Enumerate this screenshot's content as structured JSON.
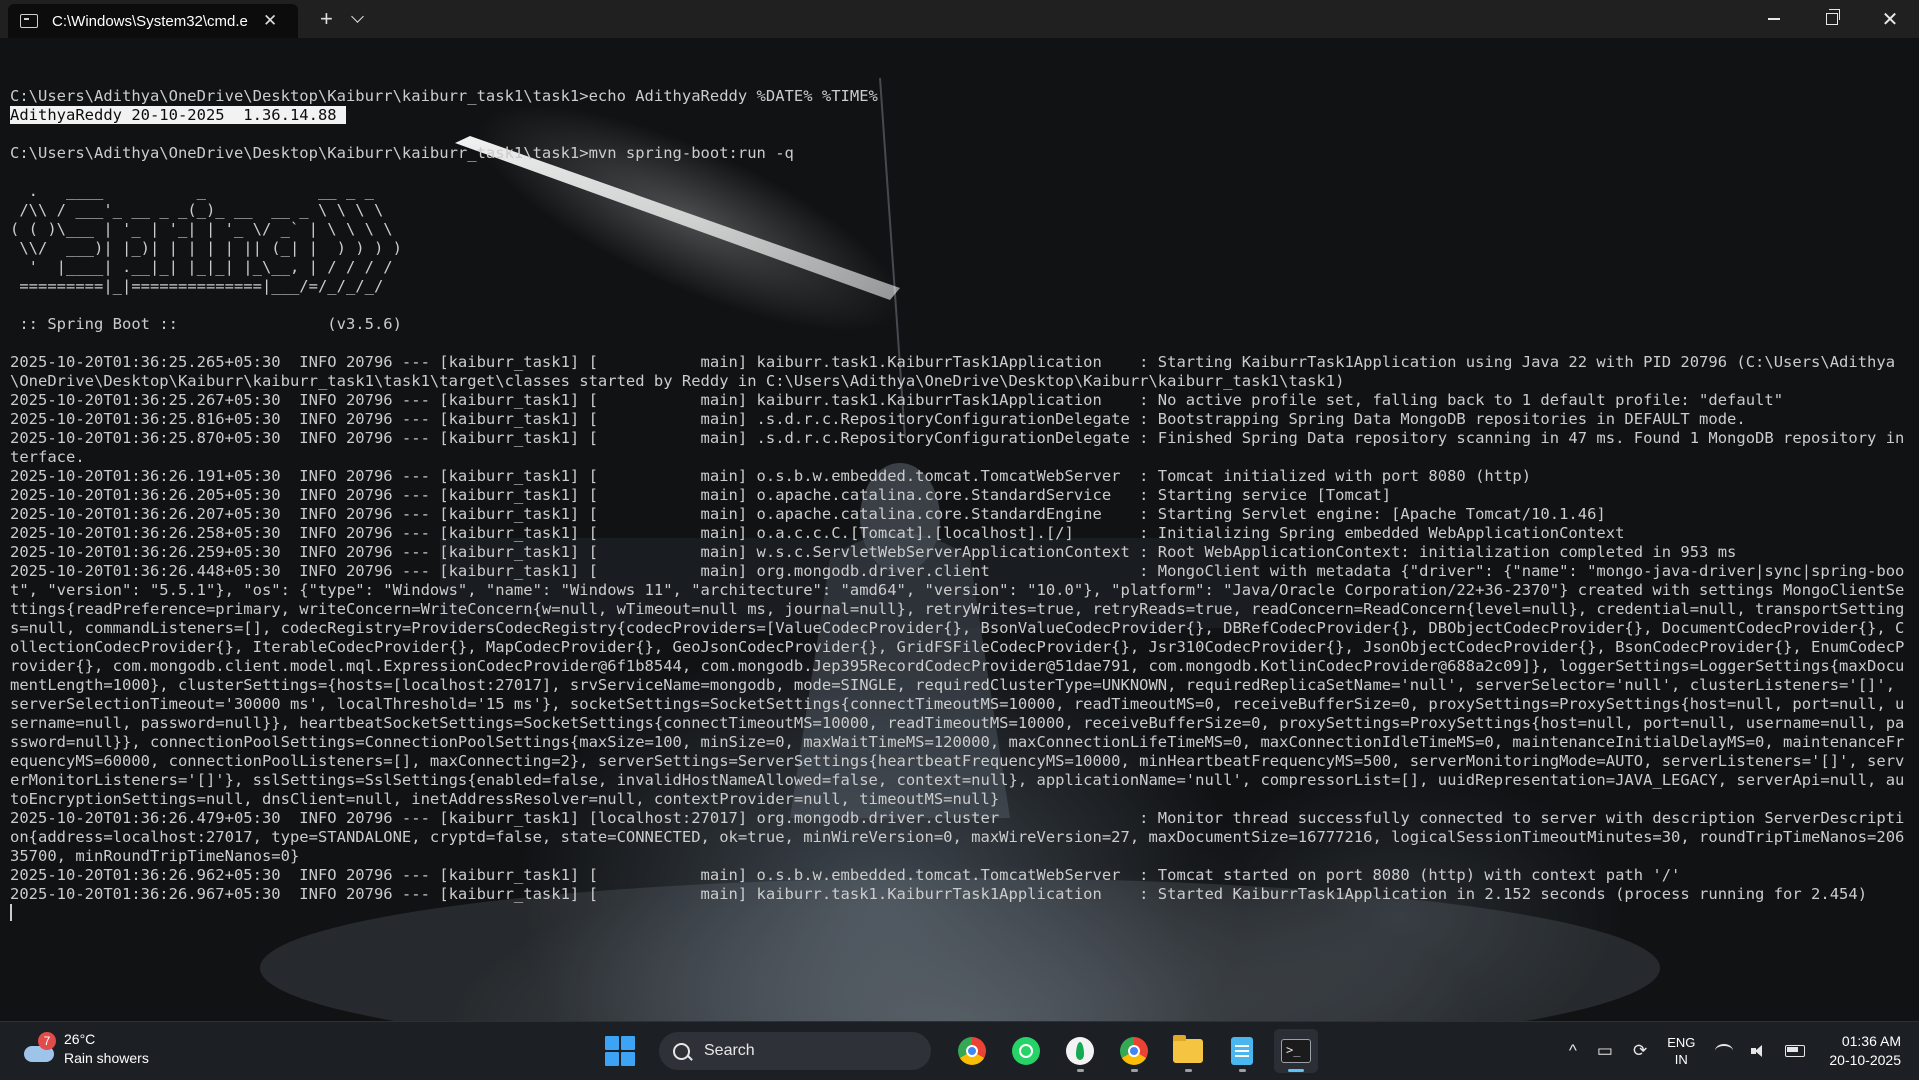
{
  "window": {
    "tab_title": "C:\\Windows\\System32\\cmd.e",
    "tab_close": "✕",
    "new_tab": "+",
    "minimize_label": "Minimize",
    "maximize_label": "Restore",
    "close_label": "✕"
  },
  "terminal": {
    "lines": [
      "",
      "C:\\Users\\Adithya\\OneDrive\\Desktop\\Kaiburr\\kaiburr_task1\\task1>echo AdithyaReddy %DATE% %TIME%",
      "AdithyaReddy 20-10-2025  1.36.14.88 ",
      "",
      "C:\\Users\\Adithya\\OneDrive\\Desktop\\Kaiburr\\kaiburr_task1\\task1>mvn spring-boot:run -q",
      "",
      "  .   ____          _            __ _ _",
      " /\\\\ / ___'_ __ _ _(_)_ __  __ _ \\ \\ \\ \\",
      "( ( )\\___ | '_ | '_| | '_ \\/ _` | \\ \\ \\ \\",
      " \\\\/  ___)| |_)| | | | | || (_| |  ) ) ) )",
      "  '  |____| .__|_| |_|_| |_\\__, | / / / /",
      " =========|_|==============|___/=/_/_/_/",
      "",
      " :: Spring Boot ::                (v3.5.6)",
      "",
      "2025-10-20T01:36:25.265+05:30  INFO 20796 --- [kaiburr_task1] [           main] kaiburr.task1.KaiburrTask1Application    : Starting KaiburrTask1Application using Java 22 with PID 20796 (C:\\Users\\Adithya\\OneDrive\\Desktop\\Kaiburr\\kaiburr_task1\\task1\\target\\classes started by Reddy in C:\\Users\\Adithya\\OneDrive\\Desktop\\Kaiburr\\kaiburr_task1\\task1)",
      "2025-10-20T01:36:25.267+05:30  INFO 20796 --- [kaiburr_task1] [           main] kaiburr.task1.KaiburrTask1Application    : No active profile set, falling back to 1 default profile: \"default\"",
      "2025-10-20T01:36:25.816+05:30  INFO 20796 --- [kaiburr_task1] [           main] .s.d.r.c.RepositoryConfigurationDelegate : Bootstrapping Spring Data MongoDB repositories in DEFAULT mode.",
      "2025-10-20T01:36:25.870+05:30  INFO 20796 --- [kaiburr_task1] [           main] .s.d.r.c.RepositoryConfigurationDelegate : Finished Spring Data repository scanning in 47 ms. Found 1 MongoDB repository interface.",
      "2025-10-20T01:36:26.191+05:30  INFO 20796 --- [kaiburr_task1] [           main] o.s.b.w.embedded.tomcat.TomcatWebServer  : Tomcat initialized with port 8080 (http)",
      "2025-10-20T01:36:26.205+05:30  INFO 20796 --- [kaiburr_task1] [           main] o.apache.catalina.core.StandardService   : Starting service [Tomcat]",
      "2025-10-20T01:36:26.207+05:30  INFO 20796 --- [kaiburr_task1] [           main] o.apache.catalina.core.StandardEngine    : Starting Servlet engine: [Apache Tomcat/10.1.46]",
      "2025-10-20T01:36:26.258+05:30  INFO 20796 --- [kaiburr_task1] [           main] o.a.c.c.C.[Tomcat].[localhost].[/]       : Initializing Spring embedded WebApplicationContext",
      "2025-10-20T01:36:26.259+05:30  INFO 20796 --- [kaiburr_task1] [           main] w.s.c.ServletWebServerApplicationContext : Root WebApplicationContext: initialization completed in 953 ms",
      "2025-10-20T01:36:26.448+05:30  INFO 20796 --- [kaiburr_task1] [           main] org.mongodb.driver.client                : MongoClient with metadata {\"driver\": {\"name\": \"mongo-java-driver|sync|spring-boot\", \"version\": \"5.5.1\"}, \"os\": {\"type\": \"Windows\", \"name\": \"Windows 11\", \"architecture\": \"amd64\", \"version\": \"10.0\"}, \"platform\": \"Java/Oracle Corporation/22+36-2370\"} created with settings MongoClientSettings{readPreference=primary, writeConcern=WriteConcern{w=null, wTimeout=null ms, journal=null}, retryWrites=true, retryReads=true, readConcern=ReadConcern{level=null}, credential=null, transportSettings=null, commandListeners=[], codecRegistry=ProvidersCodecRegistry{codecProviders=[ValueCodecProvider{}, BsonValueCodecProvider{}, DBRefCodecProvider{}, DBObjectCodecProvider{}, DocumentCodecProvider{}, CollectionCodecProvider{}, IterableCodecProvider{}, MapCodecProvider{}, GeoJsonCodecProvider{}, GridFSFileCodecProvider{}, Jsr310CodecProvider{}, JsonObjectCodecProvider{}, BsonCodecProvider{}, EnumCodecProvider{}, com.mongodb.client.model.mql.ExpressionCodecProvider@6f1b8544, com.mongodb.Jep395RecordCodecProvider@51dae791, com.mongodb.KotlinCodecProvider@688a2c09]}, loggerSettings=LoggerSettings{maxDocumentLength=1000}, clusterSettings={hosts=[localhost:27017], srvServiceName=mongodb, mode=SINGLE, requiredClusterType=UNKNOWN, requiredReplicaSetName='null', serverSelector='null', clusterListeners='[]', serverSelectionTimeout='30000 ms', localThreshold='15 ms'}, socketSettings=SocketSettings{connectTimeoutMS=10000, readTimeoutMS=0, receiveBufferSize=0, proxySettings=ProxySettings{host=null, port=null, username=null, password=null}}, heartbeatSocketSettings=SocketSettings{connectTimeoutMS=10000, readTimeoutMS=10000, receiveBufferSize=0, proxySettings=ProxySettings{host=null, port=null, username=null, password=null}}, connectionPoolSettings=ConnectionPoolSettings{maxSize=100, minSize=0, maxWaitTimeMS=120000, maxConnectionLifeTimeMS=0, maxConnectionIdleTimeMS=0, maintenanceInitialDelayMS=0, maintenanceFrequencyMS=60000, connectionPoolListeners=[], maxConnecting=2}, serverSettings=ServerSettings{heartbeatFrequencyMS=10000, minHeartbeatFrequencyMS=500, serverMonitoringMode=AUTO, serverListeners='[]', serverMonitorListeners='[]'}, sslSettings=SslSettings{enabled=false, invalidHostNameAllowed=false, context=null}, applicationName='null', compressorList=[], uuidRepresentation=JAVA_LEGACY, serverApi=null, autoEncryptionSettings=null, dnsClient=null, inetAddressResolver=null, contextProvider=null, timeoutMS=null}",
      "2025-10-20T01:36:26.479+05:30  INFO 20796 --- [kaiburr_task1] [localhost:27017] org.mongodb.driver.cluster               : Monitor thread successfully connected to server with description ServerDescription{address=localhost:27017, type=STANDALONE, cryptd=false, state=CONNECTED, ok=true, minWireVersion=0, maxWireVersion=27, maxDocumentSize=16777216, logicalSessionTimeoutMinutes=30, roundTripTimeNanos=20635700, minRoundTripTimeNanos=0}",
      "2025-10-20T01:36:26.962+05:30  INFO 20796 --- [kaiburr_task1] [           main] o.s.b.w.embedded.tomcat.TomcatWebServer  : Tomcat started on port 8080 (http) with context path '/'",
      "2025-10-20T01:36:26.967+05:30  INFO 20796 --- [kaiburr_task1] [           main] kaiburr.task1.KaiburrTask1Application    : Started KaiburrTask1Application in 2.152 seconds (process running for 2.454)"
    ],
    "highlighted_line_index": 2
  },
  "taskbar": {
    "weather": {
      "temperature": "26°C",
      "condition": "Rain showers",
      "badge": "7"
    },
    "search_placeholder": "Search",
    "apps": [
      {
        "name": "chrome-icon",
        "active": false,
        "running": false
      },
      {
        "name": "whatsapp-icon",
        "active": false,
        "running": false
      },
      {
        "name": "mongodb-compass-icon",
        "active": false,
        "running": true
      },
      {
        "name": "chrome-profile-icon",
        "active": false,
        "running": true
      },
      {
        "name": "file-explorer-icon",
        "active": false,
        "running": true
      },
      {
        "name": "notepad-icon",
        "active": false,
        "running": true
      },
      {
        "name": "terminal-icon",
        "active": true,
        "running": true
      }
    ],
    "tray": {
      "chevron": "^",
      "language": "ENG",
      "region": "IN",
      "time": "01:36 AM",
      "date": "20-10-2025"
    }
  },
  "colors": {
    "titlebar": "#202020",
    "terminal_bg": "#0c0c0c",
    "terminal_fg": "#cccccc",
    "taskbar": "#1c1f24",
    "accent": "#5cc3f5"
  }
}
